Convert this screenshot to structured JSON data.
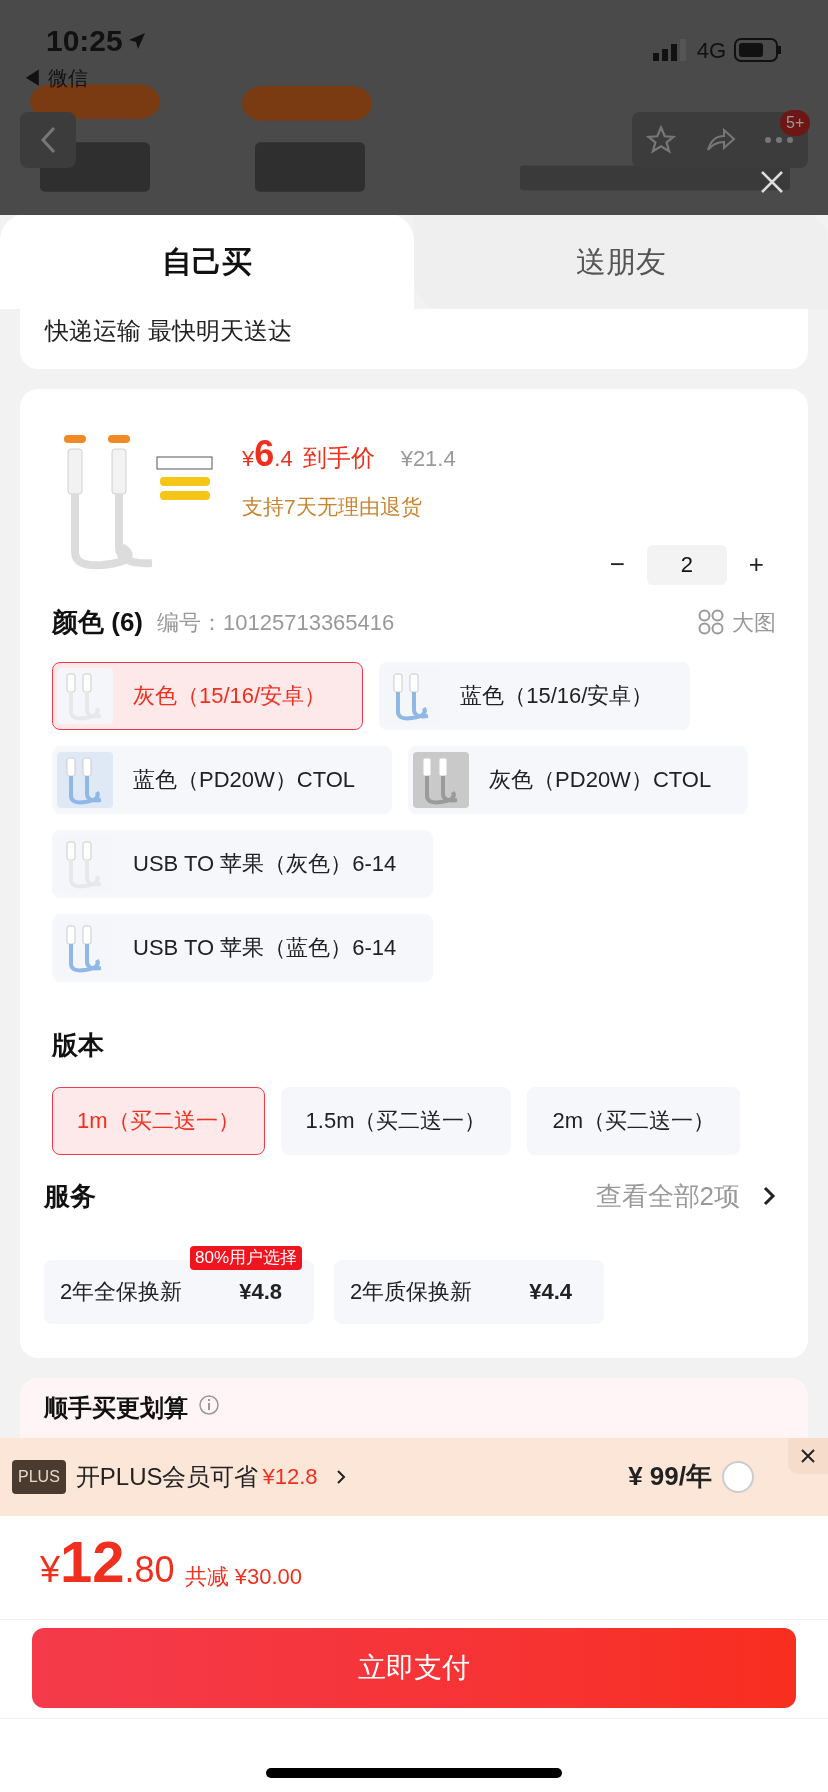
{
  "status_bar": {
    "time": "10:25",
    "back_app": "◀ 微信",
    "network": "4G"
  },
  "top_nav": {
    "badge": "5+"
  },
  "tabs": [
    {
      "label": "自己买",
      "selected": true
    },
    {
      "label": "送朋友",
      "selected": false
    }
  ],
  "delivery": "快递运输 最快明天送达",
  "product": {
    "price_symbol": "¥",
    "price_int": "6",
    "price_dec": ".4",
    "price_label": "到手价",
    "original_price": "¥21.4",
    "return_policy": "支持7天无理由退货",
    "quantity": "2",
    "minus": "−",
    "plus": "+"
  },
  "color_section": {
    "title": "颜色 (6)",
    "sku_label": "编号：",
    "sku": "10125713365416",
    "big_image": "大图",
    "options": [
      {
        "label": "灰色（15/16/安卓）",
        "selected": true
      },
      {
        "label": "蓝色（15/16/安卓）",
        "selected": false
      },
      {
        "label": "蓝色（PD20W）CTOL",
        "selected": false
      },
      {
        "label": "灰色（PD20W）CTOL",
        "selected": false
      },
      {
        "label": "USB TO 苹果（灰色）6-14",
        "selected": false
      },
      {
        "label": "USB TO 苹果（蓝色）6-14",
        "selected": false
      }
    ]
  },
  "version_section": {
    "title": "版本",
    "options": [
      {
        "label": "1m（买二送一）",
        "selected": true
      },
      {
        "label": "1.5m（买二送一）",
        "selected": false
      },
      {
        "label": "2m（买二送一）",
        "selected": false
      }
    ]
  },
  "service_section": {
    "title": "服务",
    "view_all": "查看全部2项",
    "options": [
      {
        "label": "2年全保换新",
        "price": "¥4.8",
        "badge": "80%用户选择"
      },
      {
        "label": "2年质保换新",
        "price": "¥4.4"
      }
    ]
  },
  "bundle_section": {
    "title": "顺手买更划算"
  },
  "plus_bar": {
    "logo": "PLUS",
    "text": "开PLUS会员可省",
    "saving": "¥12.8",
    "price": "¥ 99/年",
    "checked": false
  },
  "total": {
    "symbol": "¥",
    "int": "12",
    "dec": ".80",
    "discount": "共减 ¥30.00"
  },
  "pay_button": "立即支付"
}
